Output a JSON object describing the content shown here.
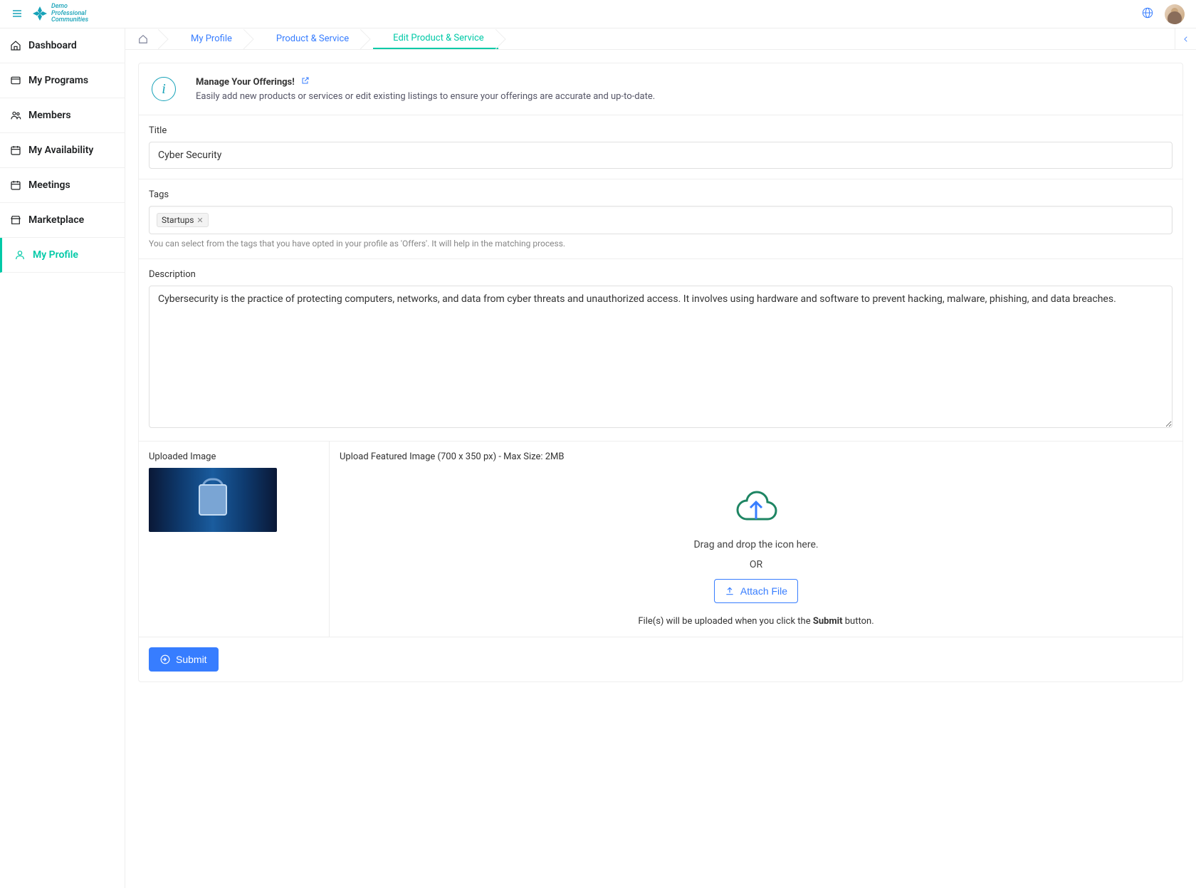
{
  "header": {
    "logo_line1": "Demo",
    "logo_line2": "Professional",
    "logo_line3": "Communities"
  },
  "sidebar": {
    "items": [
      {
        "label": "Dashboard",
        "icon": "home"
      },
      {
        "label": "My Programs",
        "icon": "folder"
      },
      {
        "label": "Members",
        "icon": "users"
      },
      {
        "label": "My Availability",
        "icon": "calendar"
      },
      {
        "label": "Meetings",
        "icon": "calendar"
      },
      {
        "label": "Marketplace",
        "icon": "store"
      },
      {
        "label": "My Profile",
        "icon": "user"
      }
    ]
  },
  "breadcrumb": {
    "items": [
      {
        "label": "My Profile"
      },
      {
        "label": "Product & Service"
      },
      {
        "label": "Edit Product & Service"
      }
    ]
  },
  "info": {
    "title": "Manage Your Offerings!",
    "desc": "Easily add new products or services or edit existing listings to ensure your offerings are accurate and up-to-date."
  },
  "form": {
    "title_label": "Title",
    "title_value": "Cyber Security",
    "tags_label": "Tags",
    "tags": [
      "Startups"
    ],
    "tags_hint": "You can select from the tags that you have opted in your profile as 'Offers'. It will help in the matching process.",
    "desc_label": "Description",
    "desc_value": "Cybersecurity is the practice of protecting computers, networks, and data from cyber threats and unauthorized access. It involves using hardware and software to prevent hacking, malware, phishing, and data breaches.",
    "uploaded_label": "Uploaded Image",
    "upload_label": "Upload Featured Image (700 x 350 px) - Max Size: 2MB",
    "dragdrop": "Drag and drop the icon here.",
    "or": "OR",
    "attach": "Attach File",
    "upload_note_prefix": "File(s) will be uploaded when you click the ",
    "upload_note_bold": "Submit",
    "upload_note_suffix": " button.",
    "submit": "Submit"
  }
}
